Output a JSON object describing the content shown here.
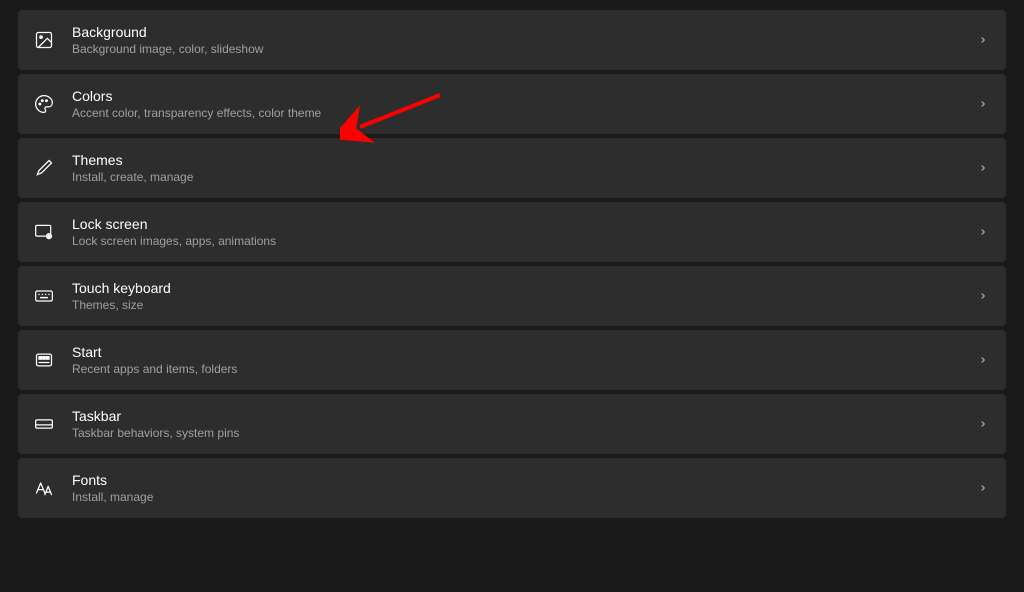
{
  "items": [
    {
      "id": "background",
      "title": "Background",
      "subtitle": "Background image, color, slideshow"
    },
    {
      "id": "colors",
      "title": "Colors",
      "subtitle": "Accent color, transparency effects, color theme"
    },
    {
      "id": "themes",
      "title": "Themes",
      "subtitle": "Install, create, manage"
    },
    {
      "id": "lockscreen",
      "title": "Lock screen",
      "subtitle": "Lock screen images, apps, animations"
    },
    {
      "id": "touchkeyboard",
      "title": "Touch keyboard",
      "subtitle": "Themes, size"
    },
    {
      "id": "start",
      "title": "Start",
      "subtitle": "Recent apps and items, folders"
    },
    {
      "id": "taskbar",
      "title": "Taskbar",
      "subtitle": "Taskbar behaviors, system pins"
    },
    {
      "id": "fonts",
      "title": "Fonts",
      "subtitle": "Install, manage"
    }
  ],
  "annotation": {
    "arrow_color": "#ff0000",
    "target": "colors"
  }
}
